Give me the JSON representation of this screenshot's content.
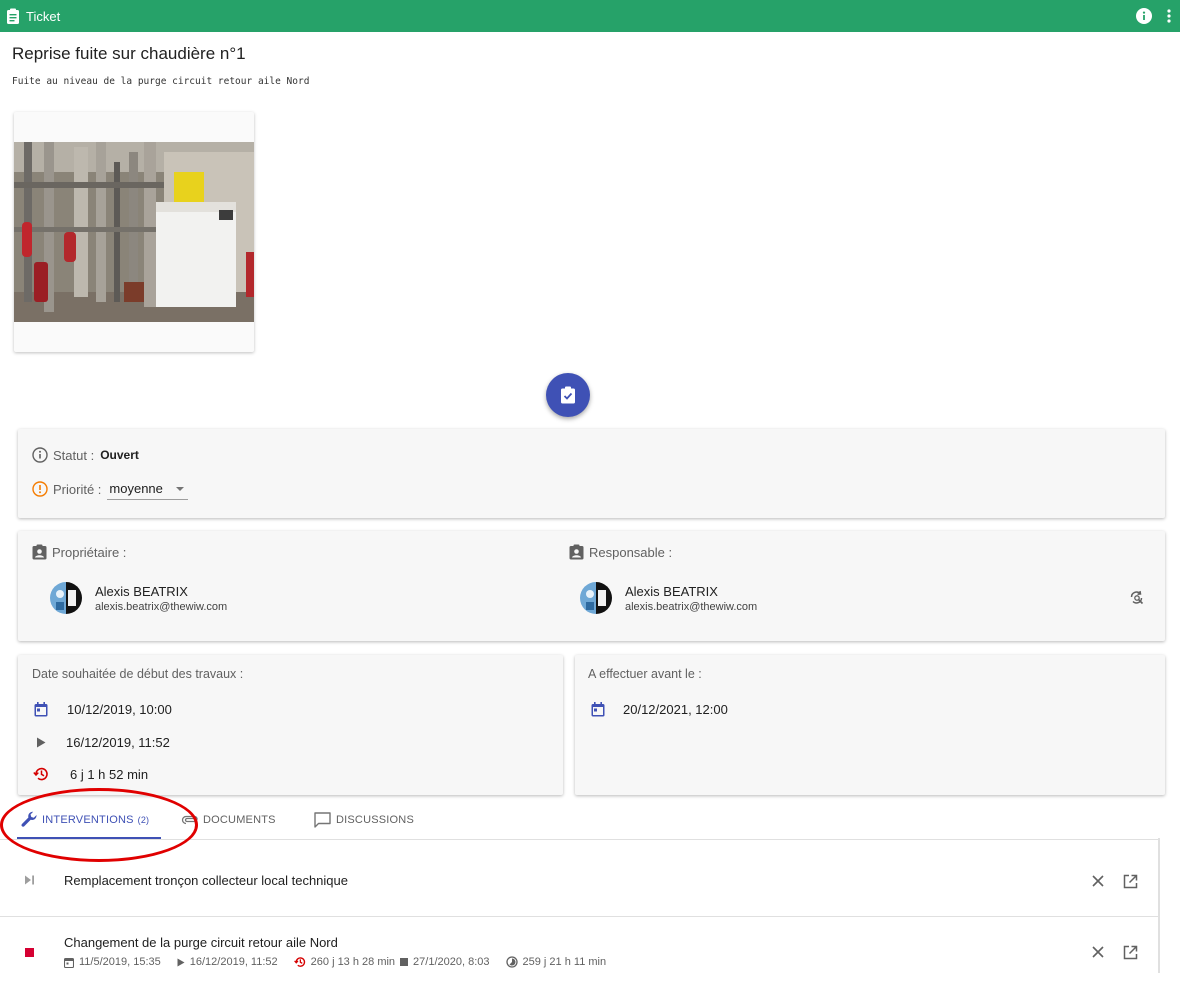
{
  "topbar": {
    "title": "Ticket",
    "color": "#26a269",
    "icons": [
      "clipboard-icon",
      "info-icon",
      "more-vert-icon"
    ]
  },
  "ticket": {
    "title": "Reprise fuite sur chaudière n°1",
    "description": "Fuite au niveau de la purge circuit retour aile Nord"
  },
  "status": {
    "status_label": "Statut :",
    "status_value": "Ouvert",
    "priority_label": "Priorité :",
    "priority_value": "moyenne"
  },
  "owner": {
    "label": "Propriétaire :",
    "name": "Alexis BEATRIX",
    "email": "alexis.beatrix@thewiw.com"
  },
  "responsible": {
    "label": "Responsable :",
    "name": "Alexis BEATRIX",
    "email": "alexis.beatrix@thewiw.com"
  },
  "dates": {
    "start_label": "Date souhaitée de début des travaux :",
    "planned_start": "10/12/2019, 10:00",
    "actual_start": "16/12/2019, 11:52",
    "delay": "6 j 1 h 52 min",
    "deadline_label": "A effectuer avant le :",
    "deadline": "20/12/2021, 12:00"
  },
  "tabs": [
    {
      "label": "INTERVENTIONS",
      "count": "(2)",
      "active": true
    },
    {
      "label": "DOCUMENTS",
      "count": "",
      "active": false
    },
    {
      "label": "DISCUSSIONS",
      "count": "",
      "active": false
    }
  ],
  "interventions": [
    {
      "title": "Remplacement tronçon collecteur local technique",
      "status_icon": "skip-next-icon"
    },
    {
      "title": "Changement de la purge circuit retour aile Nord",
      "status_icon": "stop-icon",
      "planned": "11/5/2019, 15:35",
      "started": "16/12/2019, 11:52",
      "delay": "260 j 13 h 28 min",
      "ended": "27/1/2020, 8:03",
      "duration": "259 j 21 h 11 min"
    }
  ],
  "colors": {
    "accent": "#3f51b5",
    "warning": "#f57c00",
    "danger": "#d50000",
    "annotation": "#e00000"
  }
}
